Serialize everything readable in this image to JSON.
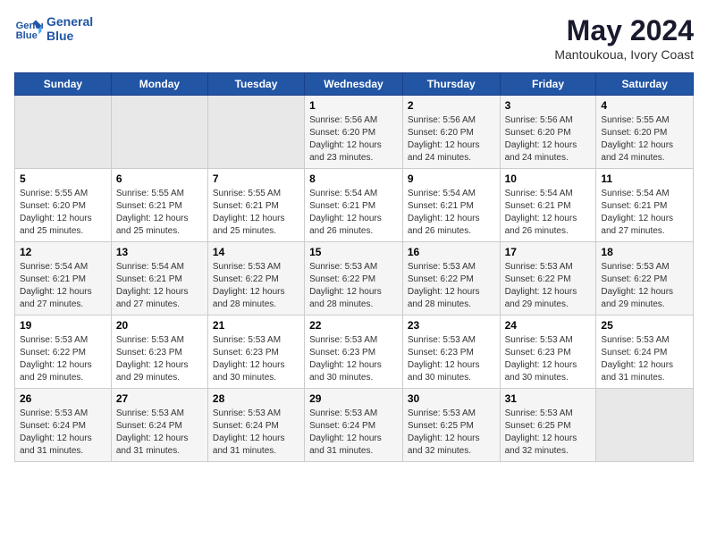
{
  "logo": {
    "line1": "General",
    "line2": "Blue"
  },
  "title": "May 2024",
  "subtitle": "Mantoukoua, Ivory Coast",
  "days_header": [
    "Sunday",
    "Monday",
    "Tuesday",
    "Wednesday",
    "Thursday",
    "Friday",
    "Saturday"
  ],
  "weeks": [
    [
      {
        "num": "",
        "info": ""
      },
      {
        "num": "",
        "info": ""
      },
      {
        "num": "",
        "info": ""
      },
      {
        "num": "1",
        "info": "Sunrise: 5:56 AM\nSunset: 6:20 PM\nDaylight: 12 hours\nand 23 minutes."
      },
      {
        "num": "2",
        "info": "Sunrise: 5:56 AM\nSunset: 6:20 PM\nDaylight: 12 hours\nand 24 minutes."
      },
      {
        "num": "3",
        "info": "Sunrise: 5:56 AM\nSunset: 6:20 PM\nDaylight: 12 hours\nand 24 minutes."
      },
      {
        "num": "4",
        "info": "Sunrise: 5:55 AM\nSunset: 6:20 PM\nDaylight: 12 hours\nand 24 minutes."
      }
    ],
    [
      {
        "num": "5",
        "info": "Sunrise: 5:55 AM\nSunset: 6:20 PM\nDaylight: 12 hours\nand 25 minutes."
      },
      {
        "num": "6",
        "info": "Sunrise: 5:55 AM\nSunset: 6:21 PM\nDaylight: 12 hours\nand 25 minutes."
      },
      {
        "num": "7",
        "info": "Sunrise: 5:55 AM\nSunset: 6:21 PM\nDaylight: 12 hours\nand 25 minutes."
      },
      {
        "num": "8",
        "info": "Sunrise: 5:54 AM\nSunset: 6:21 PM\nDaylight: 12 hours\nand 26 minutes."
      },
      {
        "num": "9",
        "info": "Sunrise: 5:54 AM\nSunset: 6:21 PM\nDaylight: 12 hours\nand 26 minutes."
      },
      {
        "num": "10",
        "info": "Sunrise: 5:54 AM\nSunset: 6:21 PM\nDaylight: 12 hours\nand 26 minutes."
      },
      {
        "num": "11",
        "info": "Sunrise: 5:54 AM\nSunset: 6:21 PM\nDaylight: 12 hours\nand 27 minutes."
      }
    ],
    [
      {
        "num": "12",
        "info": "Sunrise: 5:54 AM\nSunset: 6:21 PM\nDaylight: 12 hours\nand 27 minutes."
      },
      {
        "num": "13",
        "info": "Sunrise: 5:54 AM\nSunset: 6:21 PM\nDaylight: 12 hours\nand 27 minutes."
      },
      {
        "num": "14",
        "info": "Sunrise: 5:53 AM\nSunset: 6:22 PM\nDaylight: 12 hours\nand 28 minutes."
      },
      {
        "num": "15",
        "info": "Sunrise: 5:53 AM\nSunset: 6:22 PM\nDaylight: 12 hours\nand 28 minutes."
      },
      {
        "num": "16",
        "info": "Sunrise: 5:53 AM\nSunset: 6:22 PM\nDaylight: 12 hours\nand 28 minutes."
      },
      {
        "num": "17",
        "info": "Sunrise: 5:53 AM\nSunset: 6:22 PM\nDaylight: 12 hours\nand 29 minutes."
      },
      {
        "num": "18",
        "info": "Sunrise: 5:53 AM\nSunset: 6:22 PM\nDaylight: 12 hours\nand 29 minutes."
      }
    ],
    [
      {
        "num": "19",
        "info": "Sunrise: 5:53 AM\nSunset: 6:22 PM\nDaylight: 12 hours\nand 29 minutes."
      },
      {
        "num": "20",
        "info": "Sunrise: 5:53 AM\nSunset: 6:23 PM\nDaylight: 12 hours\nand 29 minutes."
      },
      {
        "num": "21",
        "info": "Sunrise: 5:53 AM\nSunset: 6:23 PM\nDaylight: 12 hours\nand 30 minutes."
      },
      {
        "num": "22",
        "info": "Sunrise: 5:53 AM\nSunset: 6:23 PM\nDaylight: 12 hours\nand 30 minutes."
      },
      {
        "num": "23",
        "info": "Sunrise: 5:53 AM\nSunset: 6:23 PM\nDaylight: 12 hours\nand 30 minutes."
      },
      {
        "num": "24",
        "info": "Sunrise: 5:53 AM\nSunset: 6:23 PM\nDaylight: 12 hours\nand 30 minutes."
      },
      {
        "num": "25",
        "info": "Sunrise: 5:53 AM\nSunset: 6:24 PM\nDaylight: 12 hours\nand 31 minutes."
      }
    ],
    [
      {
        "num": "26",
        "info": "Sunrise: 5:53 AM\nSunset: 6:24 PM\nDaylight: 12 hours\nand 31 minutes."
      },
      {
        "num": "27",
        "info": "Sunrise: 5:53 AM\nSunset: 6:24 PM\nDaylight: 12 hours\nand 31 minutes."
      },
      {
        "num": "28",
        "info": "Sunrise: 5:53 AM\nSunset: 6:24 PM\nDaylight: 12 hours\nand 31 minutes."
      },
      {
        "num": "29",
        "info": "Sunrise: 5:53 AM\nSunset: 6:24 PM\nDaylight: 12 hours\nand 31 minutes."
      },
      {
        "num": "30",
        "info": "Sunrise: 5:53 AM\nSunset: 6:25 PM\nDaylight: 12 hours\nand 32 minutes."
      },
      {
        "num": "31",
        "info": "Sunrise: 5:53 AM\nSunset: 6:25 PM\nDaylight: 12 hours\nand 32 minutes."
      },
      {
        "num": "",
        "info": ""
      }
    ]
  ]
}
